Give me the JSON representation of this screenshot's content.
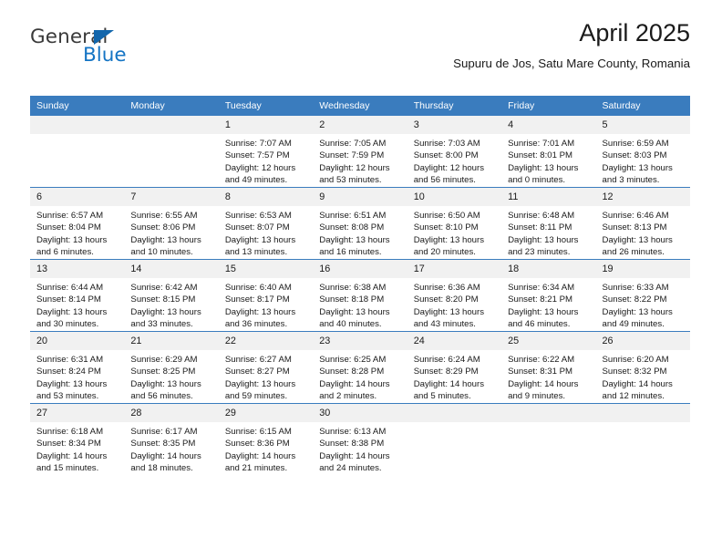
{
  "brand": {
    "name_top": "General",
    "name_bottom": "Blue",
    "accent_color": "#1474c4",
    "triangle_color": "#1266ac"
  },
  "header": {
    "title": "April 2025",
    "subtitle": "Supuru de Jos, Satu Mare County, Romania"
  },
  "calendar": {
    "header_bg": "#3a7cbe",
    "daynum_bg": "#f1f1f1",
    "weekdays": [
      "Sunday",
      "Monday",
      "Tuesday",
      "Wednesday",
      "Thursday",
      "Friday",
      "Saturday"
    ],
    "weeks": [
      [
        {
          "day": "",
          "empty": true
        },
        {
          "day": "",
          "empty": true
        },
        {
          "day": "1",
          "sunrise": "Sunrise: 7:07 AM",
          "sunset": "Sunset: 7:57 PM",
          "daylight": "Daylight: 12 hours and 49 minutes."
        },
        {
          "day": "2",
          "sunrise": "Sunrise: 7:05 AM",
          "sunset": "Sunset: 7:59 PM",
          "daylight": "Daylight: 12 hours and 53 minutes."
        },
        {
          "day": "3",
          "sunrise": "Sunrise: 7:03 AM",
          "sunset": "Sunset: 8:00 PM",
          "daylight": "Daylight: 12 hours and 56 minutes."
        },
        {
          "day": "4",
          "sunrise": "Sunrise: 7:01 AM",
          "sunset": "Sunset: 8:01 PM",
          "daylight": "Daylight: 13 hours and 0 minutes."
        },
        {
          "day": "5",
          "sunrise": "Sunrise: 6:59 AM",
          "sunset": "Sunset: 8:03 PM",
          "daylight": "Daylight: 13 hours and 3 minutes."
        }
      ],
      [
        {
          "day": "6",
          "sunrise": "Sunrise: 6:57 AM",
          "sunset": "Sunset: 8:04 PM",
          "daylight": "Daylight: 13 hours and 6 minutes."
        },
        {
          "day": "7",
          "sunrise": "Sunrise: 6:55 AM",
          "sunset": "Sunset: 8:06 PM",
          "daylight": "Daylight: 13 hours and 10 minutes."
        },
        {
          "day": "8",
          "sunrise": "Sunrise: 6:53 AM",
          "sunset": "Sunset: 8:07 PM",
          "daylight": "Daylight: 13 hours and 13 minutes."
        },
        {
          "day": "9",
          "sunrise": "Sunrise: 6:51 AM",
          "sunset": "Sunset: 8:08 PM",
          "daylight": "Daylight: 13 hours and 16 minutes."
        },
        {
          "day": "10",
          "sunrise": "Sunrise: 6:50 AM",
          "sunset": "Sunset: 8:10 PM",
          "daylight": "Daylight: 13 hours and 20 minutes."
        },
        {
          "day": "11",
          "sunrise": "Sunrise: 6:48 AM",
          "sunset": "Sunset: 8:11 PM",
          "daylight": "Daylight: 13 hours and 23 minutes."
        },
        {
          "day": "12",
          "sunrise": "Sunrise: 6:46 AM",
          "sunset": "Sunset: 8:13 PM",
          "daylight": "Daylight: 13 hours and 26 minutes."
        }
      ],
      [
        {
          "day": "13",
          "sunrise": "Sunrise: 6:44 AM",
          "sunset": "Sunset: 8:14 PM",
          "daylight": "Daylight: 13 hours and 30 minutes."
        },
        {
          "day": "14",
          "sunrise": "Sunrise: 6:42 AM",
          "sunset": "Sunset: 8:15 PM",
          "daylight": "Daylight: 13 hours and 33 minutes."
        },
        {
          "day": "15",
          "sunrise": "Sunrise: 6:40 AM",
          "sunset": "Sunset: 8:17 PM",
          "daylight": "Daylight: 13 hours and 36 minutes."
        },
        {
          "day": "16",
          "sunrise": "Sunrise: 6:38 AM",
          "sunset": "Sunset: 8:18 PM",
          "daylight": "Daylight: 13 hours and 40 minutes."
        },
        {
          "day": "17",
          "sunrise": "Sunrise: 6:36 AM",
          "sunset": "Sunset: 8:20 PM",
          "daylight": "Daylight: 13 hours and 43 minutes."
        },
        {
          "day": "18",
          "sunrise": "Sunrise: 6:34 AM",
          "sunset": "Sunset: 8:21 PM",
          "daylight": "Daylight: 13 hours and 46 minutes."
        },
        {
          "day": "19",
          "sunrise": "Sunrise: 6:33 AM",
          "sunset": "Sunset: 8:22 PM",
          "daylight": "Daylight: 13 hours and 49 minutes."
        }
      ],
      [
        {
          "day": "20",
          "sunrise": "Sunrise: 6:31 AM",
          "sunset": "Sunset: 8:24 PM",
          "daylight": "Daylight: 13 hours and 53 minutes."
        },
        {
          "day": "21",
          "sunrise": "Sunrise: 6:29 AM",
          "sunset": "Sunset: 8:25 PM",
          "daylight": "Daylight: 13 hours and 56 minutes."
        },
        {
          "day": "22",
          "sunrise": "Sunrise: 6:27 AM",
          "sunset": "Sunset: 8:27 PM",
          "daylight": "Daylight: 13 hours and 59 minutes."
        },
        {
          "day": "23",
          "sunrise": "Sunrise: 6:25 AM",
          "sunset": "Sunset: 8:28 PM",
          "daylight": "Daylight: 14 hours and 2 minutes."
        },
        {
          "day": "24",
          "sunrise": "Sunrise: 6:24 AM",
          "sunset": "Sunset: 8:29 PM",
          "daylight": "Daylight: 14 hours and 5 minutes."
        },
        {
          "day": "25",
          "sunrise": "Sunrise: 6:22 AM",
          "sunset": "Sunset: 8:31 PM",
          "daylight": "Daylight: 14 hours and 9 minutes."
        },
        {
          "day": "26",
          "sunrise": "Sunrise: 6:20 AM",
          "sunset": "Sunset: 8:32 PM",
          "daylight": "Daylight: 14 hours and 12 minutes."
        }
      ],
      [
        {
          "day": "27",
          "sunrise": "Sunrise: 6:18 AM",
          "sunset": "Sunset: 8:34 PM",
          "daylight": "Daylight: 14 hours and 15 minutes."
        },
        {
          "day": "28",
          "sunrise": "Sunrise: 6:17 AM",
          "sunset": "Sunset: 8:35 PM",
          "daylight": "Daylight: 14 hours and 18 minutes."
        },
        {
          "day": "29",
          "sunrise": "Sunrise: 6:15 AM",
          "sunset": "Sunset: 8:36 PM",
          "daylight": "Daylight: 14 hours and 21 minutes."
        },
        {
          "day": "30",
          "sunrise": "Sunrise: 6:13 AM",
          "sunset": "Sunset: 8:38 PM",
          "daylight": "Daylight: 14 hours and 24 minutes."
        },
        {
          "day": "",
          "empty": true
        },
        {
          "day": "",
          "empty": true
        },
        {
          "day": "",
          "empty": true
        }
      ]
    ]
  }
}
